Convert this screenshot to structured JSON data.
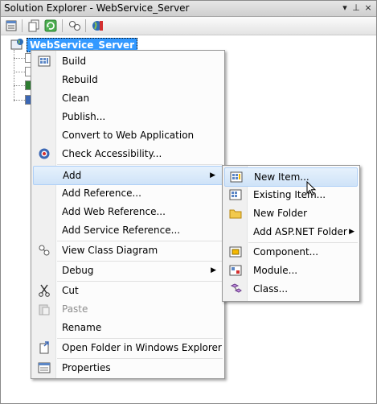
{
  "window": {
    "title": "Solution Explorer - WebService_Server",
    "controls": [
      "▾",
      "⊥",
      "×"
    ]
  },
  "toolbar": {
    "icons": [
      "properties-icon",
      "show-all-files-icon",
      "refresh-icon",
      "class-view-icon",
      "copy-website-icon"
    ]
  },
  "tree": {
    "root_label": "WebService_Server"
  },
  "context_menu": {
    "items": [
      {
        "label": "Build",
        "icon": "build-icon"
      },
      {
        "label": "Rebuild"
      },
      {
        "label": "Clean"
      },
      {
        "label": "Publish..."
      },
      {
        "label": "Convert to Web Application"
      },
      {
        "label": "Check Accessibility...",
        "icon": "accessibility-icon"
      },
      {
        "label": "Add",
        "submenu": true,
        "highlighted": true
      },
      {
        "label": "Add Reference..."
      },
      {
        "label": "Add Web Reference..."
      },
      {
        "label": "Add Service Reference..."
      },
      {
        "label": "View Class Diagram",
        "icon": "class-diagram-icon"
      },
      {
        "label": "Debug",
        "submenu": true
      },
      {
        "label": "Cut",
        "icon": "scissors-icon"
      },
      {
        "label": "Paste",
        "icon": "paste-icon",
        "disabled": true
      },
      {
        "label": "Rename"
      },
      {
        "label": "Open Folder in Windows Explorer",
        "icon": "open-folder-icon"
      },
      {
        "label": "Properties",
        "icon": "properties-icon"
      }
    ]
  },
  "add_submenu": {
    "items": [
      {
        "label": "New Item...",
        "icon": "new-item-icon",
        "highlighted": true
      },
      {
        "label": "Existing Item...",
        "icon": "existing-item-icon"
      },
      {
        "label": "New Folder",
        "icon": "folder-icon"
      },
      {
        "label": "Add ASP.NET Folder",
        "submenu": true
      },
      {
        "label": "Component...",
        "icon": "component-icon"
      },
      {
        "label": "Module...",
        "icon": "module-icon"
      },
      {
        "label": "Class...",
        "icon": "class-icon"
      }
    ]
  },
  "colors": {
    "selection": "#3399ff",
    "hover_top": "#e6f1fc",
    "hover_bottom": "#cfe3f8",
    "hover_border": "#aecff7",
    "disabled_text": "#8d8d8d"
  }
}
